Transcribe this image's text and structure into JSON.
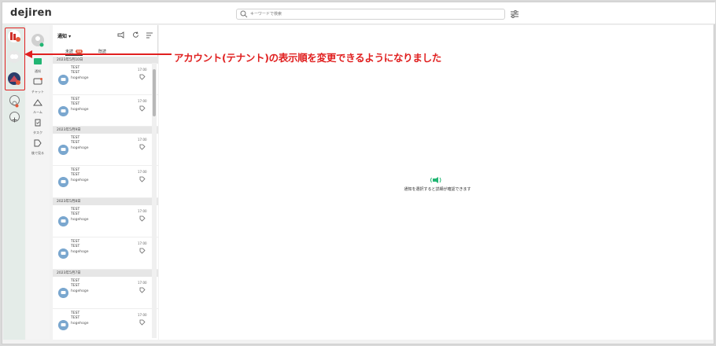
{
  "app": {
    "logo": "dejiren"
  },
  "search": {
    "placeholder": "キーワードで検索"
  },
  "nav": {
    "items": [
      {
        "label": "通知",
        "icon": "bell-icon"
      },
      {
        "label": "チャット",
        "icon": "chat-icon"
      },
      {
        "label": "ルーム",
        "icon": "room-icon"
      },
      {
        "label": "タスク",
        "icon": "task-icon"
      },
      {
        "label": "後で見る",
        "icon": "bookmark-icon"
      }
    ]
  },
  "notifications": {
    "title": "通知",
    "tabs": [
      {
        "label": "未読",
        "count": "99"
      },
      {
        "label": "既読"
      }
    ],
    "groups": [
      {
        "date": "2023年5月10日",
        "items": [
          {
            "title": "TEST",
            "sub": "TEST",
            "body": "hogehoge",
            "time": "17:00"
          },
          {
            "title": "TEST",
            "sub": "TEST",
            "body": "hogehoge",
            "time": "17:00"
          }
        ]
      },
      {
        "date": "2023年5月9日",
        "items": [
          {
            "title": "TEST",
            "sub": "TEST",
            "body": "hogehoge",
            "time": "17:00"
          },
          {
            "title": "TEST",
            "sub": "TEST",
            "body": "hogehoge",
            "time": "17:00"
          }
        ]
      },
      {
        "date": "2023年5月8日",
        "items": [
          {
            "title": "TEST",
            "sub": "TEST",
            "body": "hogehoge",
            "time": "17:00"
          },
          {
            "title": "TEST",
            "sub": "TEST",
            "body": "hogehoge",
            "time": "17:00"
          }
        ]
      },
      {
        "date": "2023年5月7日",
        "items": [
          {
            "title": "TEST",
            "sub": "TEST",
            "body": "hogehoge",
            "time": "17:00"
          },
          {
            "title": "TEST",
            "sub": "TEST",
            "body": "hogehoge",
            "time": "17:00"
          }
        ]
      }
    ]
  },
  "detail": {
    "empty_text": "通知を選択すると詳細が確認できます"
  },
  "annotation": {
    "text": "アカウント(テナント)の表示順を変更できるようになりました"
  },
  "colors": {
    "accent_green": "#22b573",
    "badge_red": "#e55a3a",
    "callout_red": "#e02020",
    "avatar_blue": "#7aa7cf"
  }
}
